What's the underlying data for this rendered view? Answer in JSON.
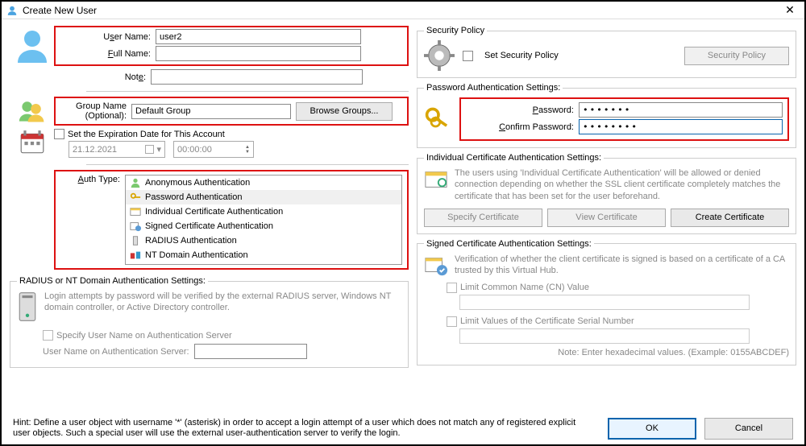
{
  "window": {
    "title": "Create New User"
  },
  "user": {
    "username_label_pre": "U",
    "username_label_u": "s",
    "username_label_post": "er Name:",
    "username": "user2",
    "fullname_label_pre": "",
    "fullname_label_u": "F",
    "fullname_label_post": "ull Name:",
    "fullname": "",
    "note_label_pre": "Not",
    "note_label_u": "e",
    "note_label_post": ":",
    "note": ""
  },
  "group": {
    "label_line1": "Group Name",
    "label_line2": "(Optional):",
    "value": "Default Group",
    "browse_btn_pre": "Browse Gro",
    "browse_btn_u": "u",
    "browse_btn_post": "ps..."
  },
  "expiration": {
    "label_pre": "",
    "label_u": "S",
    "label_post": "et the Expiration Date for This Account",
    "date": "21.12.2021",
    "time": "00:00:00"
  },
  "auth": {
    "label_pre": "",
    "label_u": "A",
    "label_post": "uth Type:",
    "items": [
      {
        "label": "Anonymous Authentication",
        "selected": false,
        "icon": "anon"
      },
      {
        "label": "Password Authentication",
        "selected": true,
        "icon": "pwd"
      },
      {
        "label": "Individual Certificate Authentication",
        "selected": false,
        "icon": "cert"
      },
      {
        "label": "Signed Certificate Authentication",
        "selected": false,
        "icon": "signed"
      },
      {
        "label": "RADIUS Authentication",
        "selected": false,
        "icon": "radius"
      },
      {
        "label": "NT Domain Authentication",
        "selected": false,
        "icon": "nt"
      }
    ]
  },
  "radius": {
    "legend": "RADIUS or NT Domain Authentication Settings:",
    "desc": "Login attempts by password will be verified by the external RADIUS server, Windows NT domain controller, or Active Directory controller.",
    "specify_label": "Specify User Name on Authentication Server",
    "username_label": "User Name on Authentication Server:",
    "username": ""
  },
  "security": {
    "legend": "Security Policy",
    "set_label": "Set Security Policy",
    "button_label": "Security Policy"
  },
  "password_auth": {
    "legend": "Password Authentication Settings:",
    "password_label_pre": "",
    "password_label_u": "P",
    "password_label_post": "assword:",
    "confirm_label_pre": "",
    "confirm_label_u": "C",
    "confirm_label_post": "onfirm Password:",
    "password": "•••••••",
    "confirm": "••••••••"
  },
  "indiv_cert": {
    "legend": "Individual Certificate Authentication Settings:",
    "desc": "The users using 'Individual Certificate Authentication' will be allowed or denied connection depending on whether the SSL client certificate completely matches the certificate that has been set for the user beforehand.",
    "specify_btn_pre": "Spec",
    "specify_btn_u": "i",
    "specify_btn_post": "fy Certificate",
    "view_btn_pre": "",
    "view_btn_u": "V",
    "view_btn_post": "iew Certificate",
    "create_btn": "Create Certificate"
  },
  "signed_cert": {
    "legend": "Signed Certificate Authentication Settings:",
    "desc": "Verification of whether the client certificate is signed is based on a certificate of a CA trusted by this Virtual Hub.",
    "limit_cn_label_pre": "",
    "limit_cn_label_u": "L",
    "limit_cn_label_post": "imit Common Name (CN) Value",
    "limit_sn_label_pre": "Li",
    "limit_sn_label_u": "m",
    "limit_sn_label_post": "it Values of the Certificate Serial Number",
    "hint": "Note: Enter hexadecimal values. (Example: 0155ABCDEF)"
  },
  "footer": {
    "hint": "Hint: Define a user object with username '*' (asterisk) in order to accept a login attempt of a user which does not match any of registered explicit user objects. Such a special user will use the external user-authentication server to verify the login.",
    "ok_pre": "",
    "ok_u": "O",
    "ok_post": "K",
    "cancel": "Cancel"
  }
}
